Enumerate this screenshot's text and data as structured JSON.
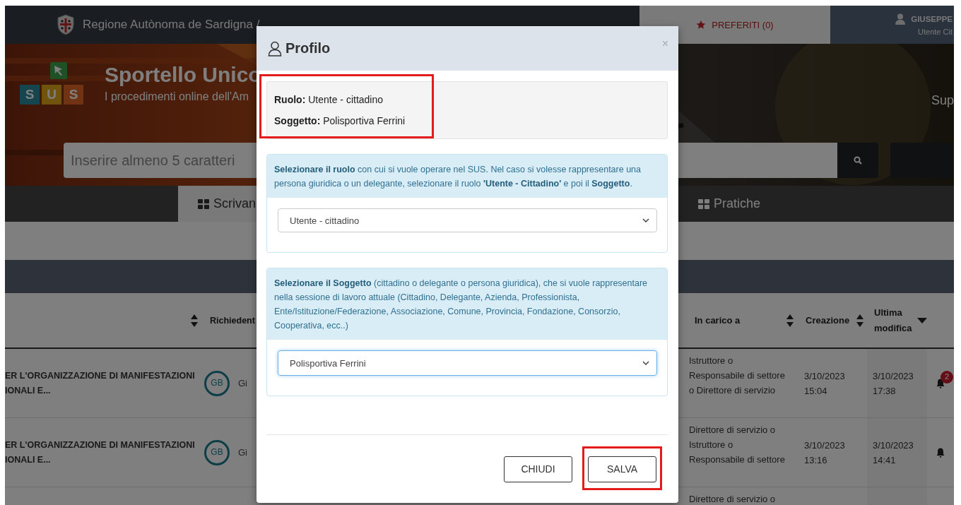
{
  "top_bar": {
    "region_name": "Regione Autònoma de Sardigna /",
    "favorites": "PREFERITI (0)",
    "user_name": "GIUSEPPE",
    "user_role": "Utente Cit"
  },
  "banner": {
    "logo_letters": [
      "S",
      "U",
      "S"
    ],
    "title": "Sportello Unico",
    "subtitle": "I procedimenti online dell'Am",
    "right_link": "Sup",
    "search": {
      "placeholder": "Inserire almeno 5 caratteri"
    }
  },
  "nav_tabs": [
    {
      "label": "Scrivan",
      "selected": true
    },
    {
      "label": "Pratiche",
      "selected": false
    }
  ],
  "table": {
    "columns": [
      {
        "sorted": false
      },
      {
        "label": "Richiedent"
      },
      {
        "label": "In carico a",
        "sorted": false
      },
      {
        "label": "Creazione",
        "sorted": false
      },
      {
        "label": "Ultima modifica",
        "sorted": true
      }
    ],
    "rows": [
      {
        "title": [
          "ER L'ORGANIZZAZIONE DI MANIFESTAZIONI",
          "IONALI E..."
        ],
        "avatar": "GB",
        "requester": "Gi",
        "in_charge": "Istruttore o Responsabile di settore o Direttore di servizio",
        "created": "3/10/2023 15:04",
        "modified": "3/10/2023 17:38",
        "badge": "2"
      },
      {
        "title": [
          "ER L'ORGANIZZAZIONE DI MANIFESTAZIONI",
          "IONALI E..."
        ],
        "avatar": "GB",
        "requester": "Gi",
        "in_charge": "Direttore di servizio o Istruttore o Responsabile di settore",
        "created": "3/10/2023 13:16",
        "modified": "3/10/2023 14:41"
      },
      {
        "in_charge": "Direttore di servizio o"
      }
    ]
  },
  "modal": {
    "title": "Profilo",
    "close": "×",
    "summary": {
      "highlighted": true,
      "lines": [
        "**Ruolo:** Utente - cittadino",
        "**Soggetto:** Polisportiva Ferrini"
      ]
    },
    "panels": [
      {
        "instructions": "**Selezionare il ruolo** con cui si vuole operare nel SUS. Nel caso si volesse rappresentare una persona giuridica o un delegante, selezionare il ruolo **'Utente - Cittadino'** e poi il **Soggetto**.",
        "select": {
          "value": "Utente - cittadino",
          "focused": false
        }
      },
      {
        "instructions": "**Selezionare il Soggetto** (cittadino o delegante o persona giuridica), che si vuole rappresentare nella sessione di lavoro attuale (Cittadino, Delegante, Azienda, Professionista, Ente/Istituzione/Federazione, Associazione, Comune, Provincia, Fondazione, Consorzio, Cooperativa, ecc..)",
        "select": {
          "value": "Polisportiva Ferrini",
          "focused": true
        }
      }
    ],
    "buttons": [
      {
        "label": "CHIUDI",
        "highlighted": false
      },
      {
        "label": "SALVA",
        "highlighted": true
      }
    ]
  }
}
